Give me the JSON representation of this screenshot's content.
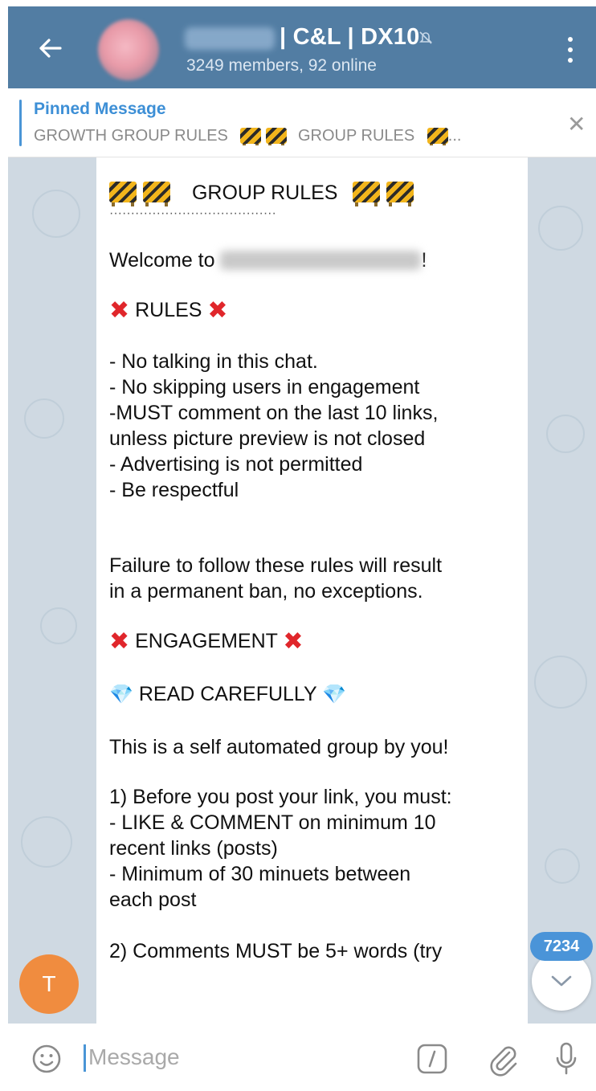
{
  "header": {
    "title": "| C&L | DX10",
    "subtitle": "3249 members, 92 online",
    "back_icon": "arrow-left-icon",
    "mute_icon": "muted-bell-icon",
    "menu_icon": "more-vertical-icon",
    "color": "#527da3"
  },
  "pinned": {
    "title": "Pinned Message",
    "preview_part1": "GROWTH GROUP RULES",
    "preview_part2": "GROUP RULES",
    "preview_end": "...",
    "close_glyph": "✕"
  },
  "message": {
    "heading": "GROUP RULES",
    "separator": "·······································",
    "welcome_prefix": "Welcome to",
    "welcome_suffix": "!",
    "rules_heading": "RULES",
    "rules": [
      "- No talking in this chat.",
      "- No skipping users in engagement",
      "-MUST comment on the last 10 links,",
      "unless picture preview is not closed",
      "- Advertising is not permitted",
      "- Be respectful"
    ],
    "failure": [
      "Failure to follow these rules will result",
      "in a permanent ban, no exceptions."
    ],
    "engagement_heading": "ENGAGEMENT",
    "read_carefully": "READ CAREFULLY",
    "self_automated": "This is a self automated group by you!",
    "step1": [
      "1) Before you post your link, you must:",
      "- LIKE & COMMENT on minimum 10",
      "recent links (posts)",
      "- Minimum of 30 minuets between",
      "each post"
    ],
    "step2_partial": "2) Comments MUST be 5+ words (try",
    "x_glyph": "✖",
    "gem_glyph": "💎"
  },
  "floating": {
    "user_initial": "T",
    "unread_count": "7234",
    "scroll_icon": "chevron-down-icon",
    "avatar_color": "#f08c3f",
    "badge_color": "#4a94d8"
  },
  "input": {
    "placeholder": "Message",
    "emoji_icon": "smile-icon",
    "command_icon": "slash-command-icon",
    "attach_icon": "paperclip-icon",
    "mic_icon": "microphone-icon"
  }
}
